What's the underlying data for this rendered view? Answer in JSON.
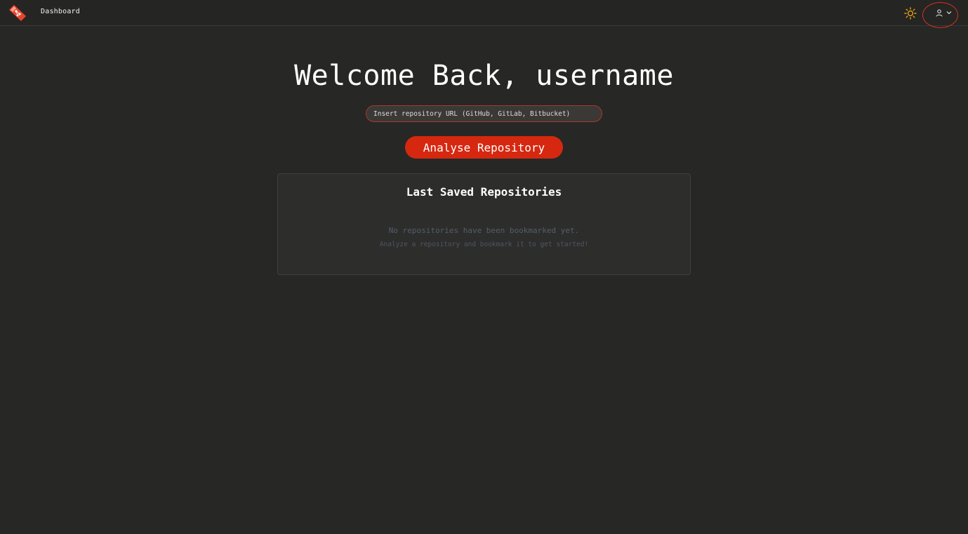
{
  "topbar": {
    "logo": "app-logo",
    "nav_dashboard": "Dashboard",
    "theme_icon": "sun-icon",
    "user_icon": "user-icon",
    "menu_icon": "chevron-down-icon",
    "highlight_color": "#d7301e"
  },
  "main": {
    "welcome": "Welcome Back, username",
    "repo_input": {
      "placeholder": "Insert repository URL (GitHub, GitLab, Bitbucket)",
      "value": ""
    },
    "analyse_button": "Analyse Repository",
    "accent_color": "#d62810"
  },
  "saved": {
    "title": "Last Saved Repositories",
    "empty_message": "No repositories have been bookmarked yet.",
    "empty_hint": "Analyze a repository and bookmark it to get started!"
  }
}
